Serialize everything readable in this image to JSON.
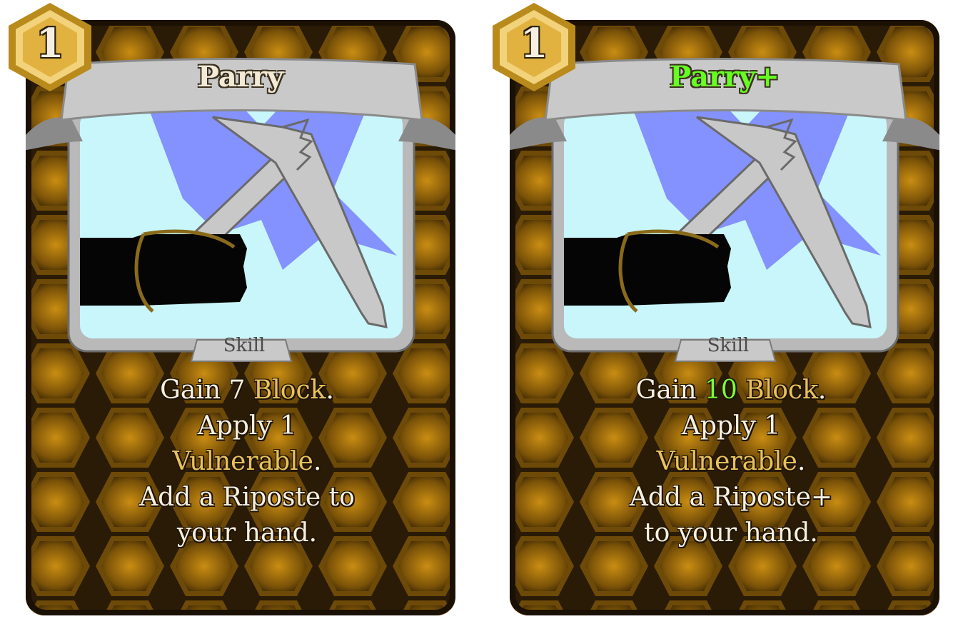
{
  "cards": [
    {
      "cost": "1",
      "title": "Parry",
      "type": "Skill",
      "description": {
        "line1_prefix": "Gain ",
        "line1_value": "7",
        "line1_keyword": "Block",
        "line1_suffix": ".",
        "line2": "Apply 1",
        "line3_keyword": "Vulnerable",
        "line3_suffix": ".",
        "line4": "Add a Riposte to",
        "line5": "your hand."
      }
    },
    {
      "cost": "1",
      "title": "Parry+",
      "type": "Skill",
      "description": {
        "line1_prefix": "Gain ",
        "line1_value": "10",
        "line1_keyword": "Block",
        "line1_suffix": ".",
        "line2": "Apply 1",
        "line3_keyword": "Vulnerable",
        "line3_suffix": ".",
        "line4": "Add a Riposte+",
        "line5": "to your hand."
      }
    }
  ],
  "colors": {
    "card_background": "#2a1b06",
    "hex_fill": "#8a5e0a",
    "hex_glow": "#d79a1a",
    "art_background": "#c8f6fb",
    "keyword": "#e8c15a",
    "upgraded": "#66ff22",
    "banner": "#c9c9c9"
  }
}
